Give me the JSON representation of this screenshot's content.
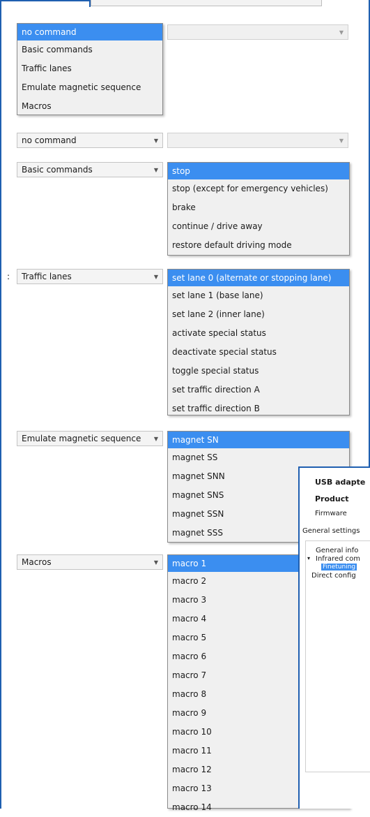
{
  "dropdown_source_menu": {
    "items": [
      "no command",
      "Basic commands",
      "Traffic lanes",
      "Emulate magnetic sequence",
      "Macros"
    ],
    "selected": 0
  },
  "row_no_command": {
    "left_value": "no command"
  },
  "row_basic": {
    "left_value": "Basic commands",
    "options": [
      "stop",
      "stop (except for emergency vehicles)",
      "brake",
      "continue / drive away",
      "restore default driving mode"
    ],
    "selected": 0
  },
  "row_traffic": {
    "prefix": ":",
    "left_value": "Traffic lanes",
    "options": [
      "set lane 0 (alternate or stopping lane)",
      "set lane 1 (base lane)",
      "set lane 2 (inner lane)",
      "activate special status",
      "deactivate special status",
      "toggle special status",
      "set traffic direction A",
      "set traffic direction B"
    ],
    "selected": 0
  },
  "row_magnet": {
    "left_value": "Emulate magnetic sequence",
    "options": [
      "magnet SN",
      "magnet SS",
      "magnet SNN",
      "magnet SNS",
      "magnet SSN",
      "magnet SSS"
    ],
    "selected": 0
  },
  "row_macros": {
    "left_value": "Macros",
    "options": [
      "macro 1",
      "macro 2",
      "macro 3",
      "macro 4",
      "macro 5",
      "macro 6",
      "macro 7",
      "macro 8",
      "macro 9",
      "macro 10",
      "macro 11",
      "macro 12",
      "macro 13",
      "macro 14"
    ],
    "selected": 0
  },
  "side_panel": {
    "usb_label": "USB adapte",
    "product_label": "Product",
    "firmware_label": "Firmware",
    "general_settings": "General settings",
    "tree": {
      "general_info": "General info",
      "infrared": "Infrared com",
      "finetuning": "Finetuning",
      "direct": "Direct config"
    }
  },
  "colors": {
    "selection": "#3b8ef0",
    "frame": "#1f5fb0"
  }
}
